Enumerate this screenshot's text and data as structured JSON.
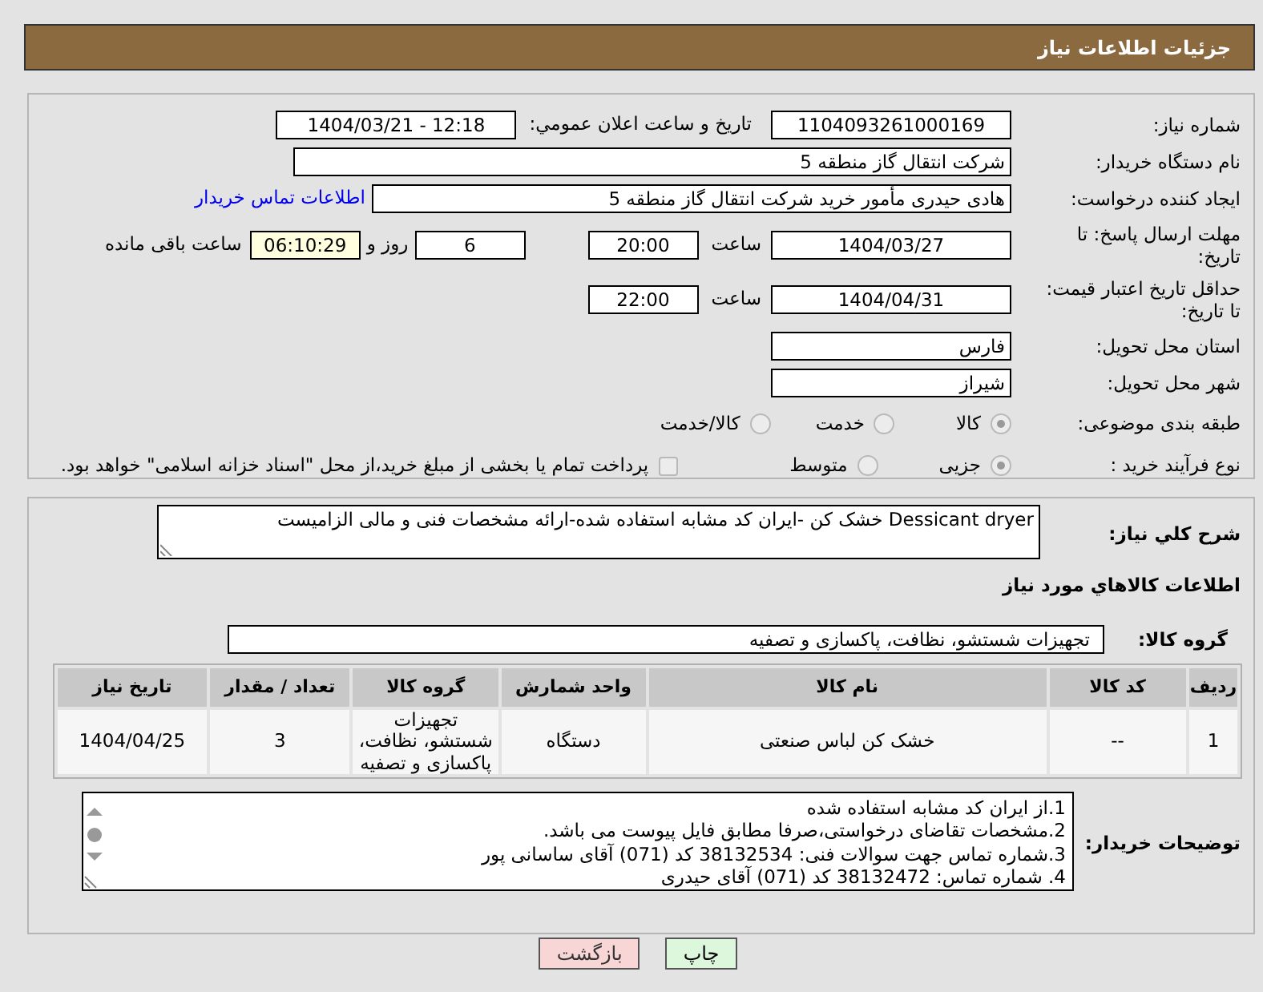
{
  "header": {
    "title": "جزئیات اطلاعات نیاز"
  },
  "need_number": {
    "label": "شماره نیاز:",
    "value": "1104093261000169"
  },
  "announce": {
    "label": "تاریخ و ساعت اعلان عمومي:",
    "value": "1404/03/21 - 12:18"
  },
  "buyer_org": {
    "label": "نام دستگاه خریدار:",
    "value": "شرکت انتقال گاز منطقه 5"
  },
  "requester": {
    "label": "ایجاد کننده درخواست:",
    "value": "هادی حیدری مأمور خرید شرکت انتقال گاز منطقه 5",
    "link": "اطلاعات تماس خریدار"
  },
  "deadline": {
    "label": "مهلت ارسال پاسخ: تا تاریخ:",
    "date": "1404/03/27",
    "time_label": "ساعت",
    "time": "20:00",
    "days": "6",
    "days_label": "روز و",
    "remaining": "06:10:29",
    "remaining_label": "ساعت باقی مانده"
  },
  "validity": {
    "label": "حداقل تاریخ اعتبار قیمت: تا تاریخ:",
    "date": "1404/04/31",
    "time_label": "ساعت",
    "time": "22:00"
  },
  "province": {
    "label": "استان محل تحویل:",
    "value": "فارس"
  },
  "city": {
    "label": "شهر محل تحویل:",
    "value": "شیراز"
  },
  "category": {
    "label": "طبقه بندی موضوعی:",
    "options": [
      {
        "label": "کالا",
        "selected": true
      },
      {
        "label": "خدمت",
        "selected": false
      },
      {
        "label": "کالا/خدمت",
        "selected": false
      }
    ]
  },
  "process": {
    "label": "نوع فرآیند خرید :",
    "options": [
      {
        "label": "جزیی",
        "selected": true
      },
      {
        "label": "متوسط",
        "selected": false
      }
    ],
    "payment": {
      "label": "پرداخت تمام یا بخشی از مبلغ خرید،از محل \"اسناد خزانه اسلامی\" خواهد بود.",
      "checked": false
    }
  },
  "description": {
    "label": "شرح کلي نياز:",
    "value": "Dessicant dryer خشک کن -ایران کد مشابه استفاده شده-ارائه مشخصات فنی و مالی الزامیست"
  },
  "goods_heading": "اطلاعات کالاهاي مورد نياز",
  "goods_group": {
    "label": "گروه کالا:",
    "value": "تجهیزات شستشو، نظافت، پاکسازی و تصفیه"
  },
  "table": {
    "columns": [
      "ردیف",
      "کد کالا",
      "نام کالا",
      "واحد شمارش",
      "گروه کالا",
      "تعداد / مقدار",
      "تاریخ نیاز"
    ],
    "rows": [
      [
        "1",
        "--",
        "خشک کن لباس صنعتی",
        "دستگاه",
        "تجهیزات شستشو، نظافت، پاکسازی و تصفیه",
        "3",
        "1404/04/25"
      ]
    ]
  },
  "buyer_notes": {
    "label": "توضیحات خریدار:",
    "lines": [
      "1.از ایران کد مشابه استفاده شده",
      "2.مشخصات تقاضای درخواستی،صرفا مطابق فایل پیوست می باشد.",
      "3.شماره تماس جهت سوالات فنی: 38132534 کد (071) آقای ساسانی پور",
      "4. شماره تماس:  38132472 کد (071) آقای حیدری"
    ]
  },
  "buttons": [
    {
      "label": "چاپ",
      "kind": "print"
    },
    {
      "label": "بازگشت",
      "kind": "back"
    }
  ]
}
